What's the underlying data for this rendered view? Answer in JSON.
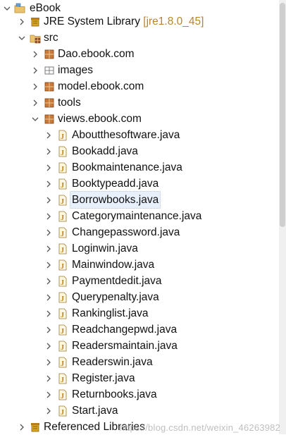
{
  "tree": {
    "project": {
      "label": "eBook"
    },
    "jre": {
      "label": "JRE System Library",
      "decoration": "[jre1.8.0_45]"
    },
    "src": {
      "label": "src"
    },
    "packages": [
      {
        "label": "Dao.ebook.com"
      },
      {
        "label": "images"
      },
      {
        "label": "model.ebook.com"
      },
      {
        "label": "tools"
      },
      {
        "label": "views.ebook.com"
      }
    ],
    "files": [
      {
        "label": "Aboutthesoftware.java"
      },
      {
        "label": "Bookadd.java"
      },
      {
        "label": "Bookmaintenance.java"
      },
      {
        "label": "Booktypeadd.java"
      },
      {
        "label": "Borrowbooks.java"
      },
      {
        "label": "Categorymaintenance.java"
      },
      {
        "label": "Changepassword.java"
      },
      {
        "label": "Loginwin.java"
      },
      {
        "label": "Mainwindow.java"
      },
      {
        "label": "Paymentdedit.java"
      },
      {
        "label": "Querypenalty.java"
      },
      {
        "label": "Rankinglist.java"
      },
      {
        "label": "Readchangepwd.java"
      },
      {
        "label": "Readersmaintain.java"
      },
      {
        "label": "Readerswin.java"
      },
      {
        "label": "Register.java"
      },
      {
        "label": "Returnbooks.java"
      },
      {
        "label": "Start.java"
      }
    ],
    "referenced": {
      "label": "Referenced Libraries"
    }
  },
  "watermark": "https://blog.csdn.net/weixin_46263982",
  "icons": {
    "project": "project-folder-icon",
    "library": "library-jar-icon",
    "source_folder": "source-folder-icon",
    "package": "package-icon",
    "java_file": "java-file-icon"
  },
  "colors": {
    "decoration": "#b8862e",
    "selection_bg": "#e8f0fb",
    "package_brown": "#a0522d",
    "java_gold": "#d9a520"
  }
}
